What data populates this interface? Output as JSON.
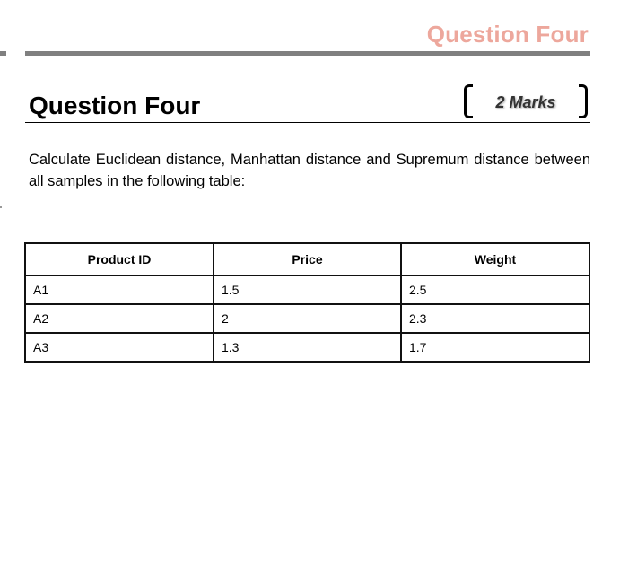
{
  "running_header": {
    "title": "Question Four",
    "color": "#eda79c"
  },
  "question": {
    "heading": "Question Four",
    "marks": "2 Marks",
    "prompt": "Calculate Euclidean distance, Manhattan distance and Supremum distance between all samples in the following table:"
  },
  "table": {
    "headers": [
      "Product ID",
      "Price",
      "Weight"
    ],
    "rows": [
      [
        "A1",
        "1.5",
        "2.5"
      ],
      [
        "A2",
        "2",
        "2.3"
      ],
      [
        "A3",
        "1.3",
        "1.7"
      ]
    ]
  }
}
